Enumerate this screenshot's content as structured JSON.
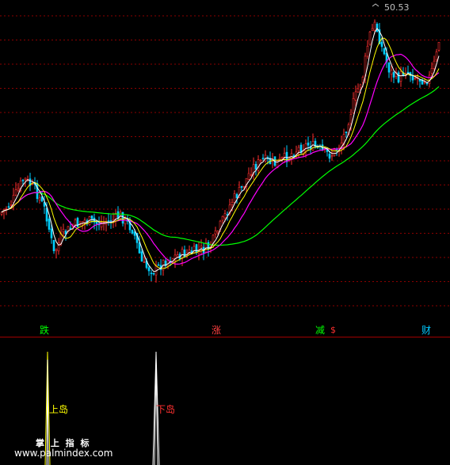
{
  "colors": {
    "background": "#000000",
    "grid": "#8b0000",
    "up": "#ff3030",
    "down": "#00d0ff",
    "ma5": "#ffffff",
    "ma10": "#ffff00",
    "ma20": "#ff00ff",
    "ma60": "#00ff00"
  },
  "price_label": "50.53",
  "markers": {
    "fall": "跌",
    "rise": "涨",
    "reduce": "减",
    "reduce_symbol": "$",
    "wealth": "财"
  },
  "sub_indicator": {
    "up_island": "上岛",
    "down_island": "下岛"
  },
  "watermark": {
    "title": "掌 上 指 标",
    "url": "www.palmindex.com"
  }
}
